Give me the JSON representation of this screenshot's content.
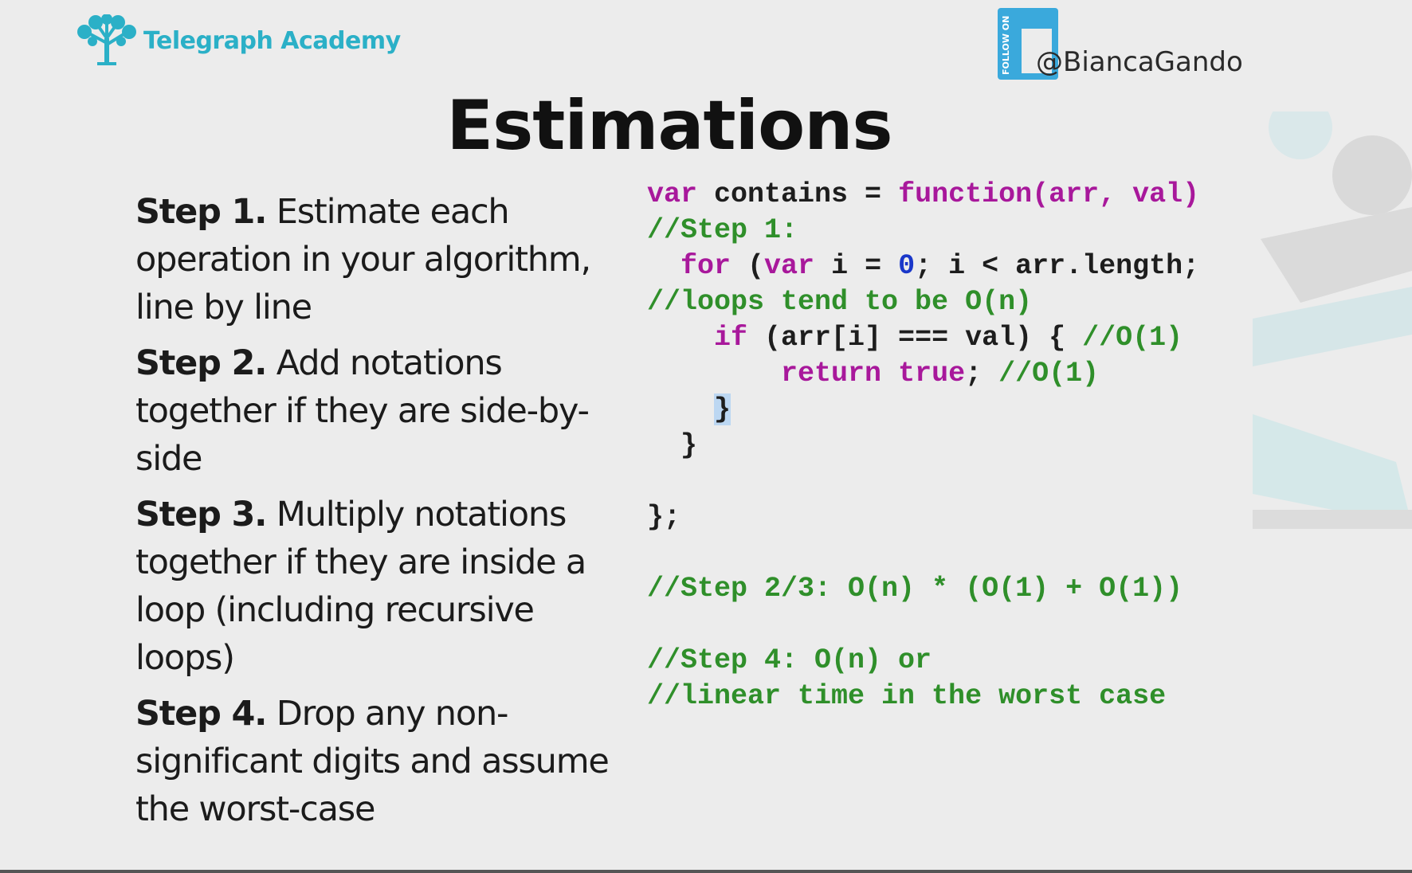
{
  "brand": {
    "name": "Telegraph Academy"
  },
  "social": {
    "badge_text": "FOLLOW ON",
    "handle": "@BiancaGando"
  },
  "slide": {
    "title": "Estimations"
  },
  "steps": [
    {
      "label": "Step 1.",
      "text": " Estimate each operation in your algorithm, line by line"
    },
    {
      "label": "Step 2.",
      "text": " Add notations together if they are side-by-side"
    },
    {
      "label": "Step 3.",
      "text": " Multiply notations together if they are inside a loop (including recursive loops)"
    },
    {
      "label": "Step 4.",
      "text": " Drop any non-significant digits and assume the worst-case"
    }
  ],
  "code": [
    [
      {
        "t": "var",
        "c": "kw"
      },
      {
        "t": " contains = ",
        "c": ""
      },
      {
        "t": "function",
        "c": "kw"
      },
      {
        "t": "(arr, val)",
        "c": "kw"
      }
    ],
    [
      {
        "t": "//Step 1:",
        "c": "cm"
      }
    ],
    [
      {
        "t": "  ",
        "c": ""
      },
      {
        "t": "for",
        "c": "kw"
      },
      {
        "t": " (",
        "c": ""
      },
      {
        "t": "var",
        "c": "kw"
      },
      {
        "t": " i = ",
        "c": ""
      },
      {
        "t": "0",
        "c": "num"
      },
      {
        "t": "; i < arr.length;",
        "c": ""
      }
    ],
    [
      {
        "t": "//loops tend to be O(n)",
        "c": "cm"
      }
    ],
    [
      {
        "t": "    ",
        "c": ""
      },
      {
        "t": "if",
        "c": "kw"
      },
      {
        "t": " (arr[i] === val) { ",
        "c": ""
      },
      {
        "t": "//O(1)",
        "c": "cm"
      }
    ],
    [
      {
        "t": "        ",
        "c": ""
      },
      {
        "t": "return",
        "c": "kw"
      },
      {
        "t": " ",
        "c": ""
      },
      {
        "t": "true",
        "c": "kw"
      },
      {
        "t": "; ",
        "c": ""
      },
      {
        "t": "//O(1)",
        "c": "cm"
      }
    ],
    [
      {
        "t": "    ",
        "c": ""
      },
      {
        "t": "}",
        "c": "hl"
      }
    ],
    [
      {
        "t": "  }",
        "c": ""
      }
    ],
    [],
    [
      {
        "t": "};",
        "c": ""
      }
    ],
    [],
    [
      {
        "t": "//Step 2/3: O(n) * (O(1) + O(1))",
        "c": "cm"
      }
    ],
    [],
    [
      {
        "t": "//Step 4: O(n) or",
        "c": "cm"
      }
    ],
    [
      {
        "t": "//linear time in the worst case",
        "c": "cm"
      }
    ]
  ],
  "colors": {
    "brand": "#2bb0c7",
    "keyword": "#a8189b",
    "comment": "#2f8f2a",
    "number": "#1a37c9"
  }
}
